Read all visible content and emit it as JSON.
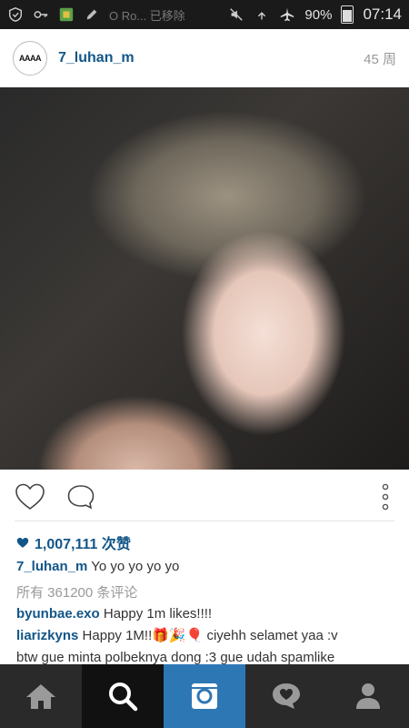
{
  "status_bar": {
    "faded_text": "O Ro... 已移除",
    "battery": "90%",
    "time": "07:14"
  },
  "post": {
    "username": "7_luhan_m",
    "avatar_text": "AAAA",
    "age": "45 周",
    "likes": "1,007,111 次赞",
    "caption": {
      "user": "7_luhan_m",
      "text": "Yo yo yo yo yo"
    },
    "all_comments": "所有 361200 条评论",
    "comments": [
      {
        "user": "byunbae.exo",
        "text": "Happy 1m likes!!!!"
      },
      {
        "user": "liarizkyns",
        "text": "Happy 1M!!🎁🎉🎈 ciyehh selamet yaa :v"
      },
      {
        "user": "",
        "text": "btw gue minta polbeknya dong :3 gue udah spamlike"
      }
    ]
  },
  "icons": {
    "like": "heart-outline-icon",
    "comment": "comment-bubble-icon",
    "more": "vertical-dots-icon",
    "nav": [
      "home-icon",
      "search-icon",
      "camera-icon",
      "activity-heart-icon",
      "profile-icon"
    ]
  },
  "colors": {
    "link_blue": "#125688",
    "camera_tab": "#2d77b5",
    "nav_bg": "#2a2a2a"
  }
}
